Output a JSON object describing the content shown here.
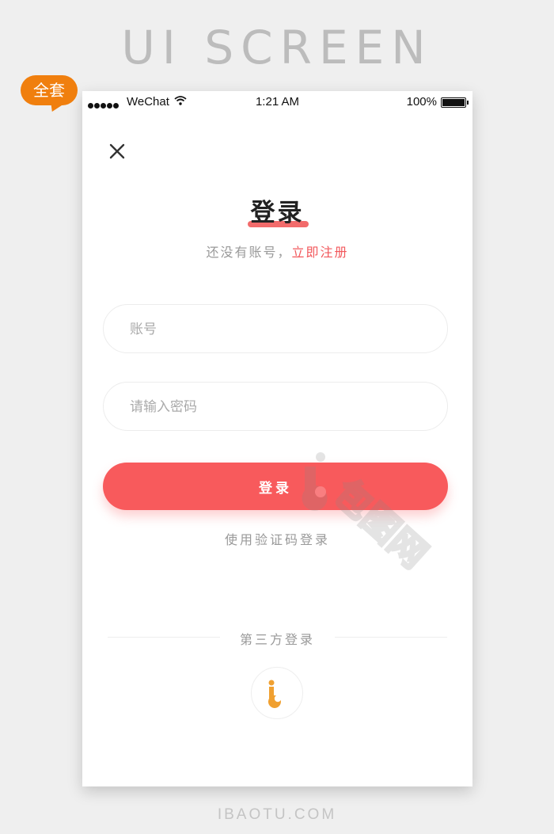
{
  "page": {
    "header_title": "UI SCREEN",
    "badge": "全套",
    "footer": "IBAOTU.COM"
  },
  "status_bar": {
    "carrier": "WeChat",
    "time": "1:21 AM",
    "battery": "100%"
  },
  "login": {
    "title": "登录",
    "no_account_text": "还没有账号，",
    "register_link": "立即注册",
    "account_placeholder": "账号",
    "password_placeholder": "请输入密码",
    "login_button": "登录",
    "sms_login": "使用验证码登录",
    "third_party_label": "第三方登录"
  },
  "watermark": {
    "text": "包图网"
  },
  "colors": {
    "accent": "#f85a5c",
    "badge": "#f07f0e",
    "third_party_icon": "#f0a030"
  },
  "icons": {
    "close": "close-icon",
    "wifi": "wifi-icon",
    "battery": "battery-icon",
    "third_party": "ibaotu-logo-icon"
  }
}
